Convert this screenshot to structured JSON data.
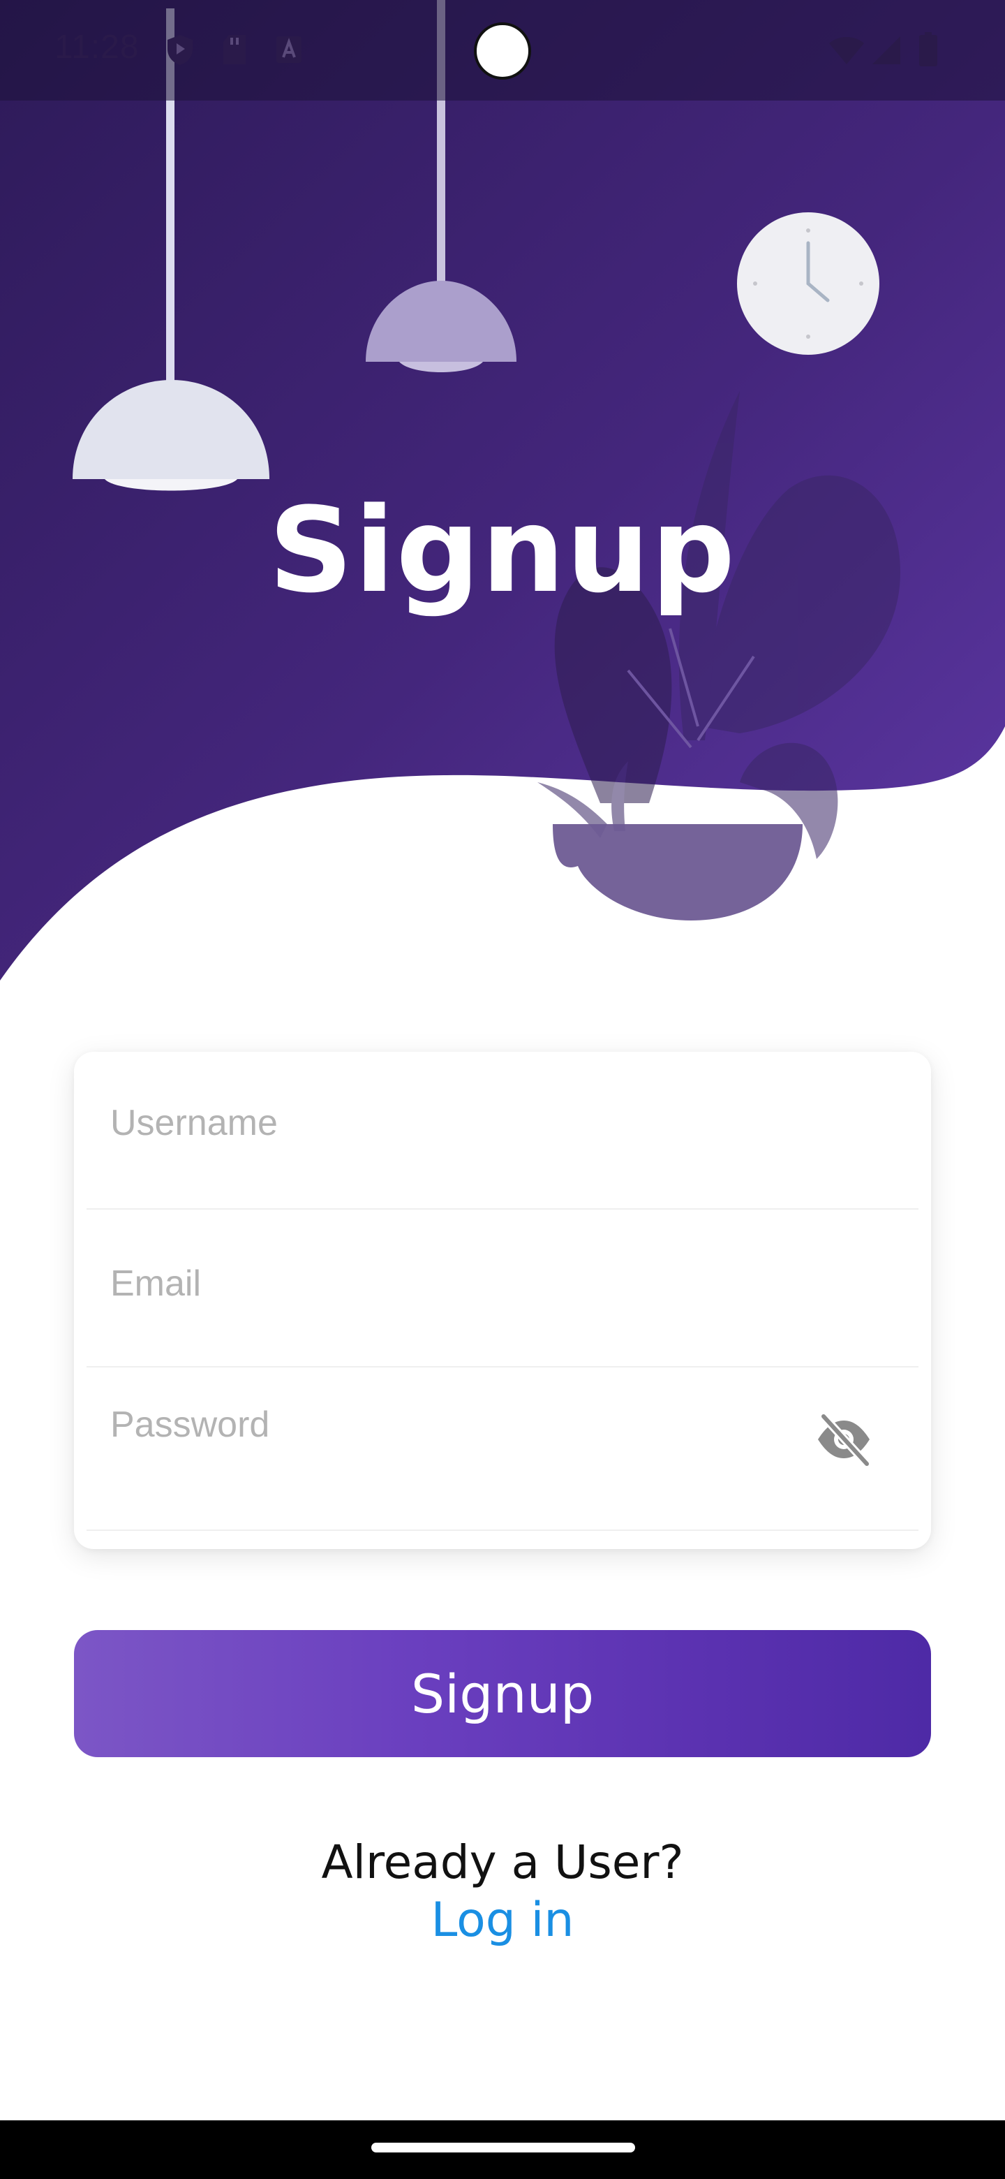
{
  "status_bar": {
    "time": "11:28"
  },
  "hero": {
    "title": "Signup"
  },
  "form": {
    "username_placeholder": "Username",
    "email_placeholder": "Email",
    "password_placeholder": "Password",
    "password_toggle_icon": "eye-off-icon"
  },
  "actions": {
    "signup_label": "Signup",
    "already_user_text": "Already a User?",
    "login_label": "Log in"
  },
  "colors": {
    "brand_purple": "#4e2aa6",
    "hero_purple_dark": "#2d1a58",
    "hero_purple_light": "#5b35a0",
    "link_blue": "#1a8fe3"
  }
}
